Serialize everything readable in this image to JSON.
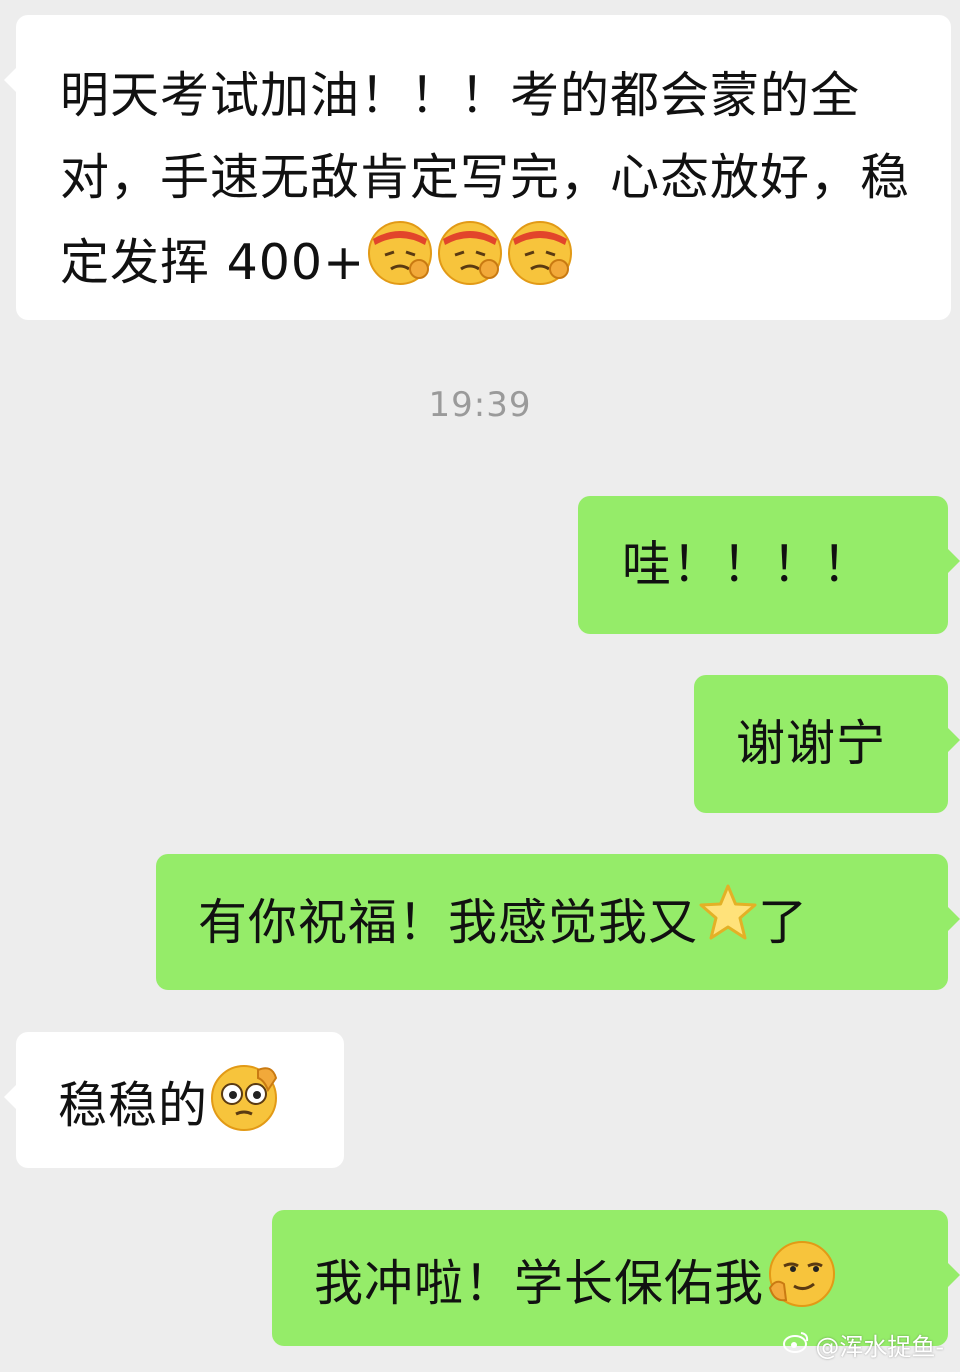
{
  "messages": [
    {
      "side": "left",
      "text": "明天考试加油！！！考的都会蒙的全对，手速无敌肯定写完，心态放好，稳定发挥 400+",
      "emoji": "determined-face x3"
    },
    {
      "side": "right",
      "text": "哇！！！！"
    },
    {
      "side": "right",
      "text": "谢谢宁"
    },
    {
      "side": "right",
      "text_before": "有你祝福！我感觉我又",
      "text_after": "了",
      "emoji": "star"
    },
    {
      "side": "left",
      "text": "稳稳的",
      "emoji": "thinking-face"
    },
    {
      "side": "right",
      "text": "我冲啦！学长保佑我",
      "emoji": "smirking-face"
    }
  ],
  "timestamp": "19:39",
  "watermark": "@浑水捉鱼-",
  "colors": {
    "background": "#ededed",
    "incoming_bubble": "#ffffff",
    "outgoing_bubble": "#95ec69"
  }
}
